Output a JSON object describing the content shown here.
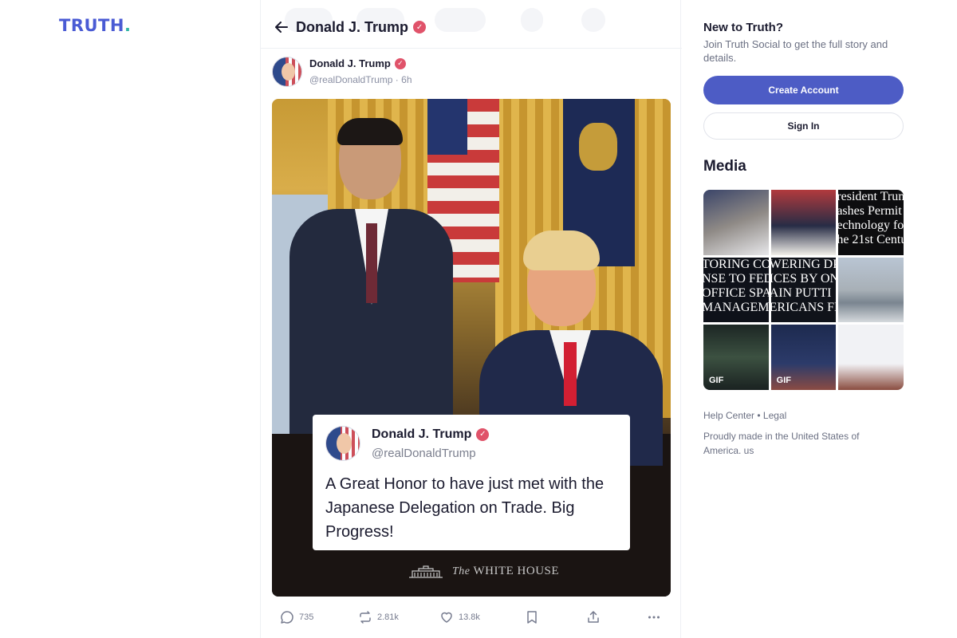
{
  "brand": {
    "logo_text": "TRUTH",
    "logo_dot": ".",
    "logo_color": "#4a5bd4",
    "dot_color": "#31b5a4"
  },
  "header": {
    "title": "Donald J. Trump",
    "back_icon": "arrow-left-icon"
  },
  "post": {
    "author_name": "Donald J. Trump",
    "handle": "@realDonaldTrump",
    "separator": "·",
    "time_ago": "6h",
    "verified_icon": "verified-check-icon",
    "quote_card": {
      "name": "Donald J. Trump",
      "handle": "@realDonaldTrump",
      "text": "A Great Honor to have just met with the Japanese Delegation on Trade. Big Progress!"
    },
    "watermark": {
      "prefix": "The",
      "text": "WHITE HOUSE"
    },
    "actions": {
      "replies": "735",
      "retruths": "2.81k",
      "likes": "13.8k",
      "bookmark_icon": "bookmark-icon",
      "share_icon": "share-icon",
      "more_icon": "more-horizontal-icon"
    }
  },
  "sidebar": {
    "title": "New to Truth?",
    "description": "Join Truth Social to get the full story and details.",
    "create_account": "Create Account",
    "sign_in": "Sign In",
    "media_title": "Media",
    "media_tiles": [
      {
        "label": ""
      },
      {
        "label": ""
      },
      {
        "label": "resident Trum\nashes Permit\nechnology fo\nhe 21st Centur"
      },
      {
        "label": "TORING COMI\nNSE TO FEDER\nOFFICE SPACE\nMANAGEMENT"
      },
      {
        "label": "WERING DR\nICES BY ON\nAIN PUTTI\nERICANS FI"
      },
      {
        "label": ""
      },
      {
        "label": "",
        "badge": "GIF"
      },
      {
        "label": "",
        "badge": "GIF"
      },
      {
        "label": ""
      }
    ],
    "footer_help": "Help Center",
    "footer_bullet": "•",
    "footer_legal": "Legal",
    "footer_note": "Proudly made in the United States of America. us"
  },
  "colors": {
    "primary_button": "#4d5cc5",
    "verified_badge": "#e0536a",
    "muted_text": "#6b7083"
  }
}
